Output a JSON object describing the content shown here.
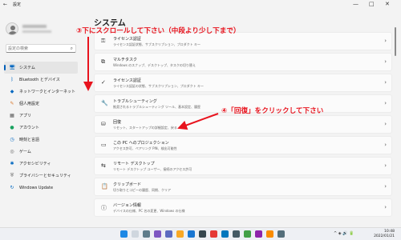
{
  "window": {
    "title": "設定",
    "back_glyph": "←",
    "minimize_glyph": "—",
    "maximize_glyph": "□",
    "close_glyph": "✕"
  },
  "search": {
    "placeholder": "設定の検索",
    "icon": "search-icon",
    "icon_glyph": "⌕"
  },
  "sidebar": {
    "items": [
      {
        "name": "system",
        "label": "システム",
        "icon": "monitor-icon",
        "glyph": "🖥",
        "color": "#0067c0",
        "active": true
      },
      {
        "name": "bluetooth",
        "label": "Bluetooth とデバイス",
        "icon": "bluetooth-icon",
        "glyph": "ᛒ",
        "color": "#0067c0"
      },
      {
        "name": "network",
        "label": "ネットワークとインターネット",
        "icon": "wifi-icon",
        "glyph": "◆",
        "color": "#0067c0"
      },
      {
        "name": "personalization",
        "label": "個人用設定",
        "icon": "brush-icon",
        "glyph": "✎",
        "color": "#d9772b"
      },
      {
        "name": "apps",
        "label": "アプリ",
        "icon": "apps-icon",
        "glyph": "▦",
        "color": "#555555"
      },
      {
        "name": "accounts",
        "label": "アカウント",
        "icon": "person-icon",
        "glyph": "●",
        "color": "#1aa260"
      },
      {
        "name": "time-language",
        "label": "時刻と言語",
        "icon": "globe-icon",
        "glyph": "◷",
        "color": "#0067c0"
      },
      {
        "name": "gaming",
        "label": "ゲーム",
        "icon": "gamepad-icon",
        "glyph": "◎",
        "color": "#666666"
      },
      {
        "name": "accessibility",
        "label": "アクセシビリティ",
        "icon": "accessibility-icon",
        "glyph": "✱",
        "color": "#0067c0"
      },
      {
        "name": "privacy",
        "label": "プライバシーとセキュリティ",
        "icon": "shield-icon",
        "glyph": "⛨",
        "color": "#666666"
      },
      {
        "name": "windows-update",
        "label": "Windows Update",
        "icon": "update-icon",
        "glyph": "↻",
        "color": "#0067c0"
      }
    ]
  },
  "main": {
    "title": "システム",
    "cards": [
      {
        "name": "activation",
        "title": "ライセンス認証",
        "sub": "ライセンス認証状態、サブスクリプション、プロダクト キー",
        "icon": "key-icon",
        "glyph": "⚿"
      },
      {
        "name": "multitasking",
        "title": "マルチタスク",
        "sub": "Windows のスナップ、デスクトップ、タスクの切り替え",
        "icon": "multitask-icon",
        "glyph": "⧉"
      },
      {
        "name": "license",
        "title": "ライセンス認証",
        "sub": "ライセンス認証の状態、サブスクリプション、プロダクト キー",
        "icon": "check-icon",
        "glyph": "✓"
      },
      {
        "name": "troubleshoot",
        "title": "トラブルシューティング",
        "sub": "推奨されるトラブルシューティング ツール、基本設定、履歴",
        "icon": "wrench-icon",
        "glyph": "🔧"
      },
      {
        "name": "recovery",
        "title": "回復",
        "sub": "リセット、スタートアップの詳細設定、戻る",
        "icon": "recovery-icon",
        "glyph": "⛁"
      },
      {
        "name": "projecting",
        "title": "この PC へのプロジェクション",
        "sub": "アクセス許可、ペアリング PIN、検出可能性",
        "icon": "project-icon",
        "glyph": "▭"
      },
      {
        "name": "remote-desktop",
        "title": "リモート デスクトップ",
        "sub": "リモート デスクトップ ユーザー、接続のアクセス許可",
        "icon": "remote-icon",
        "glyph": "⇆"
      },
      {
        "name": "clipboard",
        "title": "クリップボード",
        "sub": "切り取りとコピーの履歴、同期、クリア",
        "icon": "clipboard-icon",
        "glyph": "📋"
      },
      {
        "name": "about",
        "title": "バージョン情報",
        "sub": "デバイスの仕様、PC 名の変更、Windows の仕様",
        "icon": "info-icon",
        "glyph": "ⓘ"
      }
    ],
    "chevron_glyph": "›"
  },
  "annotations": {
    "step3": "③下にスクロールして下さい（中段より少し下まで）",
    "step4": "④「回復」をクリックして下さい",
    "color": "#e8141e"
  },
  "taskbar": {
    "tray_glyphs": "^  ◈  🔊  🔋",
    "time": "10:48",
    "date": "2022/01/21"
  }
}
